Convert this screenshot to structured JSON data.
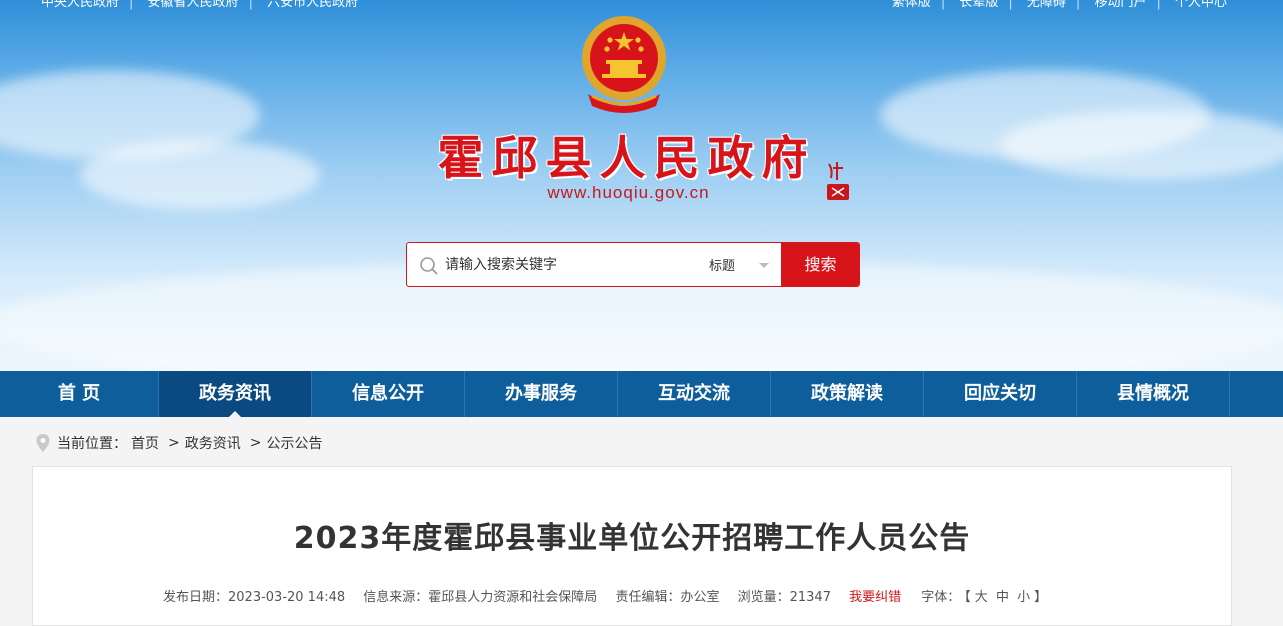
{
  "top_links": {
    "left": [
      "中央人民政府",
      "安徽省人民政府",
      "六安市人民政府"
    ],
    "right": [
      "繁体版",
      "长辈版",
      "无障碍",
      "移动门户",
      "个人中心"
    ]
  },
  "site": {
    "title": "霍邱县人民政府",
    "url": "www.huoqiu.gov.cn"
  },
  "search": {
    "placeholder": "请输入搜索关键字",
    "scope": "标题",
    "button": "搜索"
  },
  "nav": {
    "items": [
      "首 页",
      "政务资讯",
      "信息公开",
      "办事服务",
      "互动交流",
      "政策解读",
      "回应关切",
      "县情概况"
    ],
    "active_index": 1
  },
  "breadcrumb": {
    "label": "当前位置：",
    "items": [
      "首页",
      "政务资讯",
      "公示公告"
    ],
    "separator": ">"
  },
  "article": {
    "title": "2023年度霍邱县事业单位公开招聘工作人员公告",
    "meta": {
      "date": "发布日期：2023-03-20 14:48",
      "source": "信息来源：霍邱县人力资源和社会保障局",
      "editor": "责任编辑：办公室",
      "views": "浏览量：21347",
      "report": "我要纠错",
      "font_label": "字体：",
      "font_open": "【",
      "font_large": "大",
      "font_medium": "中",
      "font_small": "小",
      "font_close": "】"
    }
  },
  "colors": {
    "brand_red": "#d6141a",
    "nav_blue": "#0f5e9c"
  }
}
